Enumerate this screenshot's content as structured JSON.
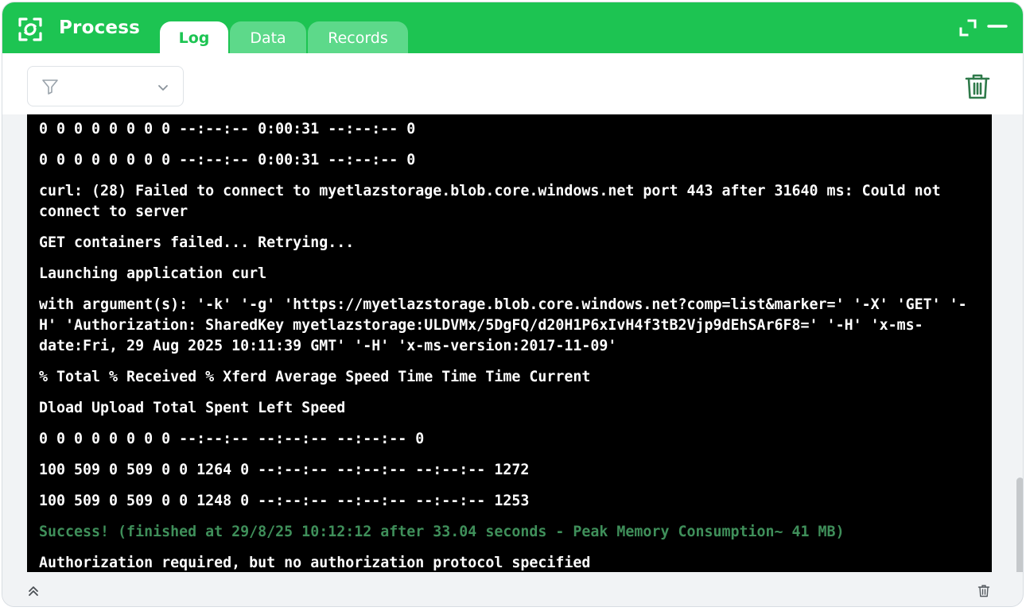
{
  "app": {
    "title": "Process",
    "tabs": [
      {
        "label": "Log",
        "active": true
      },
      {
        "label": "Data",
        "active": false
      },
      {
        "label": "Records",
        "active": false
      }
    ],
    "accent_color": "#1dc452"
  },
  "header_icons": [
    "expand-icon",
    "minimize-icon"
  ],
  "toolbar": {
    "filter_icon": "filter-icon",
    "filter_value": "",
    "clear_icon": "trash-icon"
  },
  "log": {
    "lines": [
      "0 0 0 0 0 0 0 0 --:--:-- 0:00:31 --:--:-- 0",
      "0 0 0 0 0 0 0 0 --:--:-- 0:00:31 --:--:-- 0",
      "curl: (28) Failed to connect to myetlazstorage.blob.core.windows.net port 443 after 31640 ms: Could not connect to server",
      "GET containers failed... Retrying...",
      "Launching application curl",
      "with argument(s): '-k' '-g' 'https://myetlazstorage.blob.core.windows.net?comp=list&marker=' '-X' 'GET' '-H' 'Authorization: SharedKey myetlazstorage:ULDVMx/5DgFQ/d20H1P6xIvH4f3tB2Vjp9dEhSAr6F8=' '-H' 'x-ms-date:Fri, 29 Aug 2025 10:11:39 GMT' '-H' 'x-ms-version:2017-11-09'",
      "% Total % Received % Xferd Average Speed Time Time Time Current",
      "Dload Upload Total Spent Left Speed",
      "0 0 0 0 0 0 0 0 --:--:-- --:--:-- --:--:-- 0",
      "100 509 0 509 0 0 1264 0 --:--:-- --:--:-- --:--:-- 1272",
      "100 509 0 509 0 0 1248 0 --:--:-- --:--:-- --:--:-- 1253",
      "Success! (finished at 29/8/25 10:12:12 after 33.04 seconds - Peak Memory Consumption~ 41 MB)",
      "Authorization required, but no authorization protocol specified"
    ],
    "success_line_color": "#3f8f5a"
  },
  "footer": {
    "collapse_icon": "double-chevron-up-icon",
    "clear_icon": "trash-icon"
  }
}
